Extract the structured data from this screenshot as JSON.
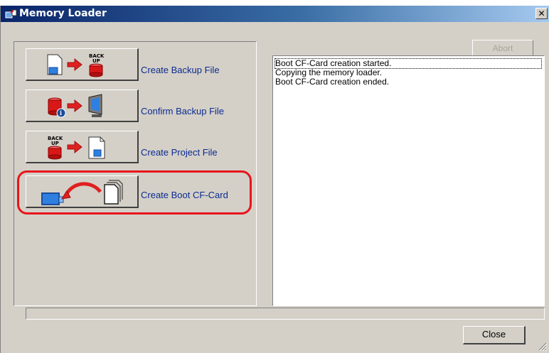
{
  "window": {
    "title": "Memory Loader",
    "close_glyph": "✕"
  },
  "actions": [
    {
      "label": "Create Backup File",
      "icon": "page-to-backup-drum-icon",
      "highlighted": false
    },
    {
      "label": "Confirm Backup File",
      "icon": "drum-to-monitor-icon",
      "highlighted": false
    },
    {
      "label": "Create Project File",
      "icon": "backup-drum-to-page-icon",
      "highlighted": false
    },
    {
      "label": "Create Boot CF-Card",
      "icon": "display-to-cfcard-icon",
      "highlighted": true
    }
  ],
  "abort_button": {
    "label": "Abort",
    "enabled": false
  },
  "log": {
    "lines": [
      "Boot CF-Card creation started.",
      "Copying the memory loader.",
      "Boot CF-Card creation ended."
    ]
  },
  "close_button": {
    "label": "Close"
  },
  "colors": {
    "highlight": "#e8151b",
    "label_text": "#0b2a8f",
    "arrow": "#e02020"
  }
}
